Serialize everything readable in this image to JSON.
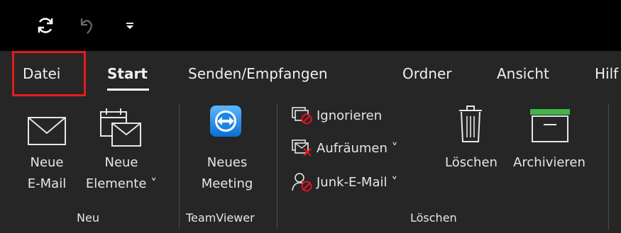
{
  "tabs": [
    {
      "label": "Datei"
    },
    {
      "label": "Start"
    },
    {
      "label": "Senden/Empfangen"
    },
    {
      "label": "Ordner"
    },
    {
      "label": "Ansicht"
    },
    {
      "label": "Hilf"
    }
  ],
  "qat": {
    "icons": [
      "sync-icon",
      "undo-icon",
      "customize-qat-icon"
    ]
  },
  "ribbon": {
    "neu": {
      "new_email_line1": "Neue",
      "new_email_line2": "E-Mail",
      "new_items_line1": "Neue",
      "new_items_line2": "Elemente ˅",
      "group_label": "Neu"
    },
    "teamviewer": {
      "meeting_line1": "Neues",
      "meeting_line2": "Meeting",
      "group_label": "TeamViewer"
    },
    "loeschen": {
      "ignore": "Ignorieren",
      "cleanup": "Aufräumen ˅",
      "junk": "Junk-E-Mail ˅",
      "delete": "Löschen",
      "archive": "Archivieren",
      "group_label": "Löschen"
    }
  },
  "colors": {
    "highlight": "#e41b1b",
    "tab_bg": "#262626",
    "title_bg": "#000000",
    "teamviewer_blue": "#0e8ee9",
    "archive_green": "#3fb54a",
    "delete_red": "#e81123"
  }
}
